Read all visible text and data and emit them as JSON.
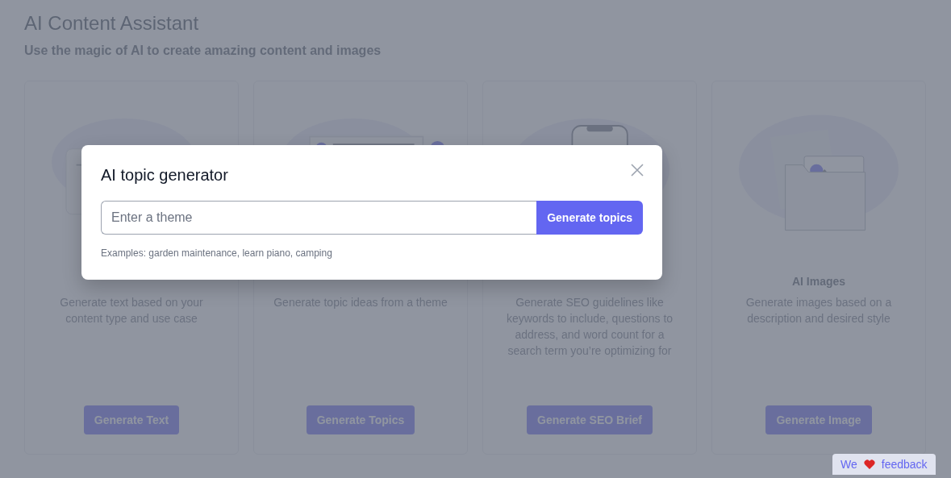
{
  "page": {
    "title": "AI Content Assistant",
    "subtitle": "Use the magic of AI to create amazing content and images"
  },
  "cards": [
    {
      "kind": "text",
      "description": "Generate text based on your content type and use case",
      "button": "Generate Text"
    },
    {
      "kind": "topics",
      "description": "Generate topic ideas from a theme",
      "button": "Generate Topics"
    },
    {
      "kind": "seo",
      "description": "Generate SEO guidelines like keywords to include, questions to address, and word count for a search term you’re optimizing for",
      "button": "Generate SEO Brief"
    },
    {
      "kind": "images",
      "title": "AI Images",
      "description": "Generate images based on a description and desired style",
      "button": "Generate Image"
    }
  ],
  "modal": {
    "title": "AI topic generator",
    "input": {
      "placeholder": "Enter a theme"
    },
    "button": "Generate topics",
    "hint": "Examples: garden maintenance, learn piano, camping"
  },
  "feedback": {
    "before": "We",
    "after": "feedback"
  }
}
